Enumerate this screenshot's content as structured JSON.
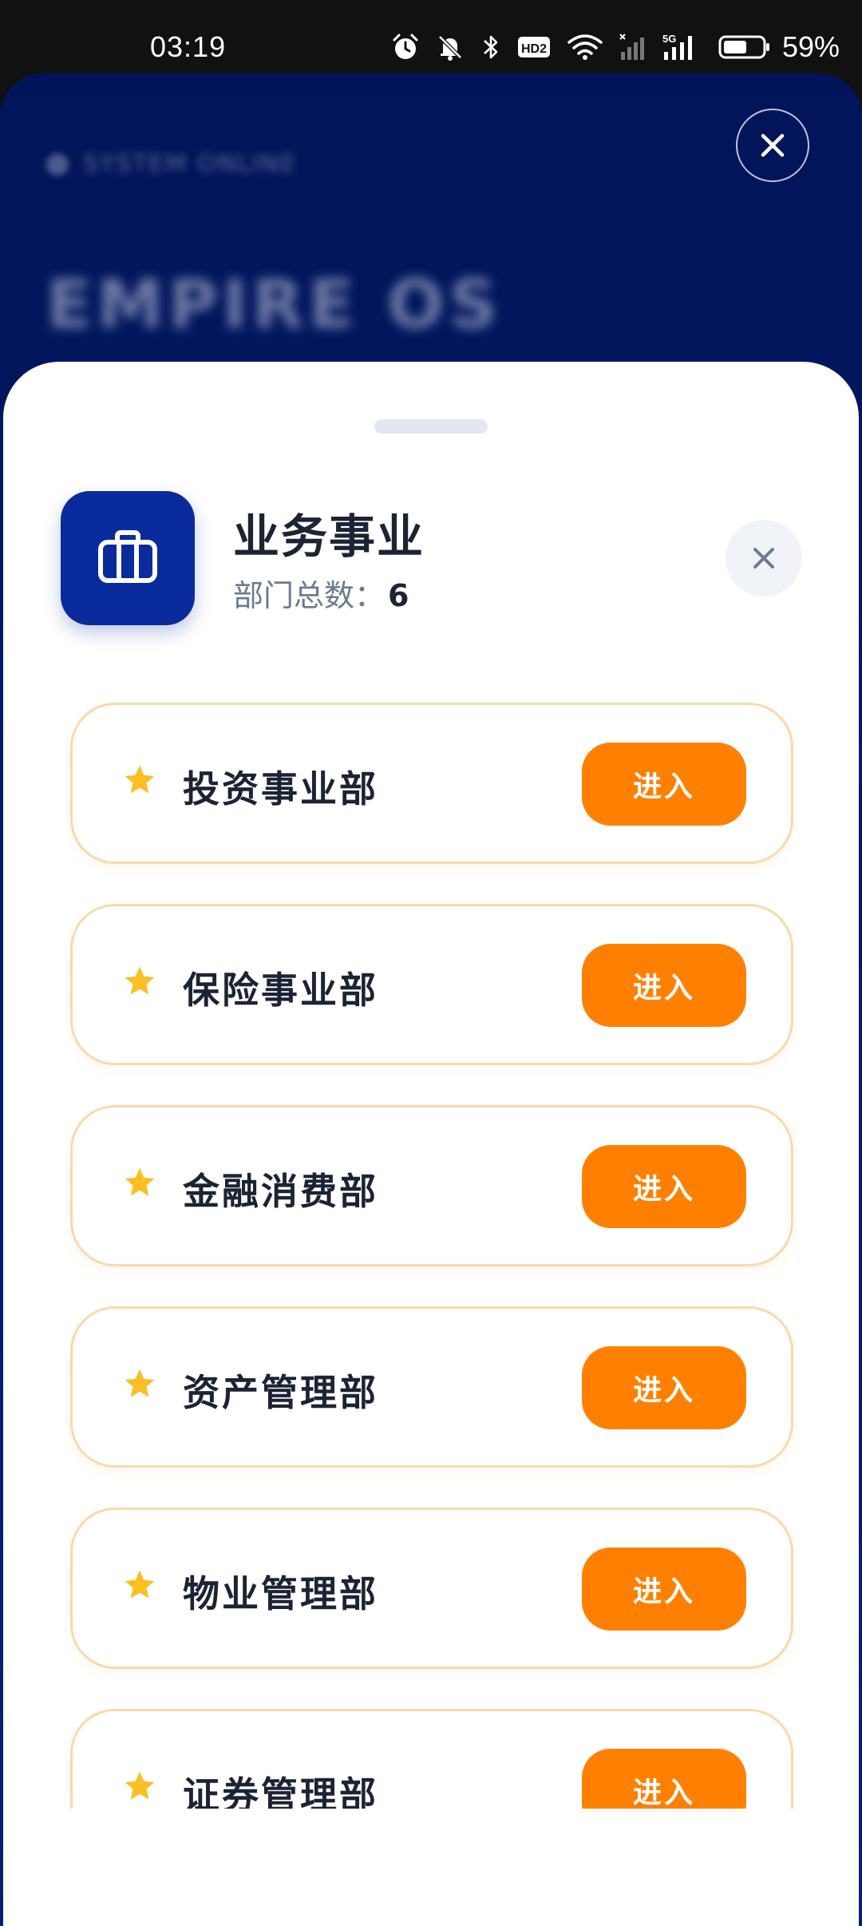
{
  "status_bar": {
    "time": "03:19",
    "battery_percent": "59%",
    "icons": [
      "alarm-icon",
      "bell-off-icon",
      "bluetooth-icon",
      "hd-icon",
      "wifi-icon",
      "signal-icon",
      "signal-5g-icon",
      "battery-icon"
    ],
    "network_label": "5G",
    "hd_label": "HD2"
  },
  "background_app": {
    "title": "EMPIRE OS",
    "subtitle": "SYSTEM ONLINE"
  },
  "sheet": {
    "title": "业务事业",
    "count_label": "部门总数：",
    "count_value": "6",
    "header_icon": "briefcase-icon",
    "items": [
      {
        "label": "投资事业部",
        "button": "进入"
      },
      {
        "label": "保险事业部",
        "button": "进入"
      },
      {
        "label": "金融消费部",
        "button": "进入"
      },
      {
        "label": "资产管理部",
        "button": "进入"
      },
      {
        "label": "物业管理部",
        "button": "进入"
      },
      {
        "label": "证券管理部",
        "button": "进入"
      }
    ]
  },
  "colors": {
    "primary": "#0a2b9c",
    "accent": "#ff8000",
    "star": "#fbbf24",
    "card_border": "#fbd9ac"
  }
}
